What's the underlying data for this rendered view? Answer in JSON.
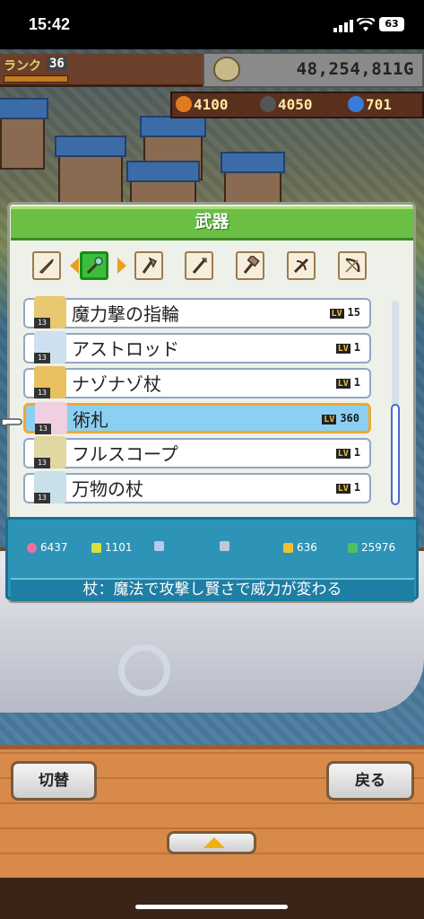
{
  "status": {
    "time": "15:42",
    "battery": "63"
  },
  "hud": {
    "rank_label": "ランク",
    "rank_value": "36",
    "money": "48,254,811G",
    "resources": [
      "4100",
      "4050",
      "701"
    ]
  },
  "panel": {
    "title": "武器",
    "categories": [
      "sword-icon",
      "staff-icon",
      "axe-icon",
      "spear-icon",
      "hammer-icon",
      "crossbow-icon",
      "bow-icon"
    ],
    "selected_category": 1
  },
  "items": [
    {
      "name": "魔力撃の指輪",
      "lv": "15",
      "qty": "13"
    },
    {
      "name": "アストロッド",
      "lv": "1",
      "qty": "13"
    },
    {
      "name": "ナゾナゾ杖",
      "lv": "1",
      "qty": "13"
    },
    {
      "name": "術札",
      "lv": "360",
      "qty": "13",
      "selected": true
    },
    {
      "name": "フルスコープ",
      "lv": "1",
      "qty": "13"
    },
    {
      "name": "万物の杖",
      "lv": "1",
      "qty": "13"
    }
  ],
  "lv_label": "LV",
  "stats": {
    "hp": "6437",
    "atk": "1101",
    "mp": "",
    "def": "",
    "price": "636",
    "value": "25976"
  },
  "description": "杖：魔法で攻撃し賢さで威力が変わる",
  "buttons": {
    "switch": "切替",
    "back": "戻る"
  },
  "colors": {
    "accent_green": "#6bbf45",
    "stat_panel": "#2d93b7",
    "selection": "#8bd0f2"
  }
}
